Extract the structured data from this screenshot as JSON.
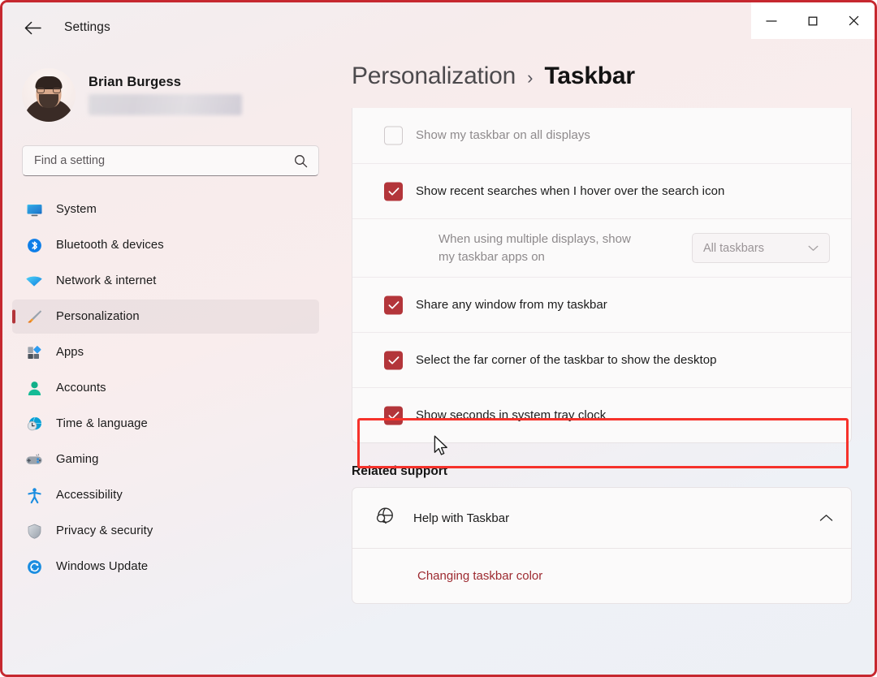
{
  "window": {
    "titlebar_title": "Settings",
    "back_icon": "back-arrow-icon",
    "controls": {
      "minimize": "minimize-icon",
      "maximize": "maximize-icon",
      "close": "close-icon"
    }
  },
  "accent_colors": {
    "checkbox_accent": "#b3353a",
    "selection_bar": "#b3353a",
    "support_link": "#9d2a30",
    "annotation_border": "#f6322b"
  },
  "sidebar": {
    "profile": {
      "name": "Brian Burgess",
      "email_redacted": true
    },
    "search": {
      "placeholder": "Find a setting",
      "value": "",
      "icon": "search-icon"
    },
    "items": [
      {
        "label": "System",
        "icon": "monitor-icon",
        "selected": false
      },
      {
        "label": "Bluetooth & devices",
        "icon": "bluetooth-icon",
        "selected": false
      },
      {
        "label": "Network & internet",
        "icon": "wifi-icon",
        "selected": false
      },
      {
        "label": "Personalization",
        "icon": "paintbrush-icon",
        "selected": true
      },
      {
        "label": "Apps",
        "icon": "apps-icon",
        "selected": false
      },
      {
        "label": "Accounts",
        "icon": "person-icon",
        "selected": false
      },
      {
        "label": "Time & language",
        "icon": "clock-globe-icon",
        "selected": false
      },
      {
        "label": "Gaming",
        "icon": "gamepad-icon",
        "selected": false
      },
      {
        "label": "Accessibility",
        "icon": "accessibility-icon",
        "selected": false
      },
      {
        "label": "Privacy & security",
        "icon": "shield-icon",
        "selected": false
      },
      {
        "label": "Windows Update",
        "icon": "update-icon",
        "selected": false
      }
    ]
  },
  "main": {
    "breadcrumb": {
      "parent": "Personalization",
      "separator": "›",
      "current": "Taskbar"
    },
    "settings_rows": [
      {
        "label": "Show my taskbar on all displays",
        "checked": false,
        "disabled": true
      },
      {
        "label": "Show recent searches when I hover over the search icon",
        "checked": true,
        "disabled": false
      },
      {
        "label": "Share any window from my taskbar",
        "checked": true,
        "disabled": false
      },
      {
        "label": "Select the far corner of the taskbar to show the desktop",
        "checked": true,
        "disabled": false
      },
      {
        "label": "Show seconds in system tray clock",
        "checked": true,
        "disabled": false,
        "highlighted": true
      }
    ],
    "multi_display": {
      "label": "When using multiple displays, show my taskbar apps on",
      "dropdown_value": "All taskbars",
      "dropdown_icon": "chevron-down-icon",
      "disabled": true
    },
    "related_support": {
      "heading": "Related support",
      "help_row": {
        "label": "Help with Taskbar",
        "icon": "globe-search-icon",
        "expand_icon": "chevron-up-icon",
        "expanded": true
      },
      "links": [
        {
          "label": "Changing taskbar color"
        }
      ]
    }
  }
}
